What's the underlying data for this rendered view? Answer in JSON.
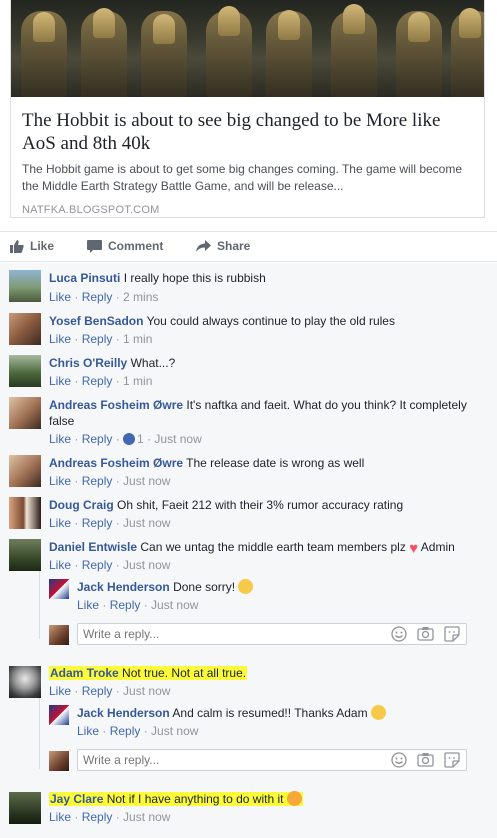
{
  "link_card": {
    "title": "The Hobbit is about to see big changed to be More like AoS and 8th 40k",
    "description": "The Hobbit game is about to get some big changes coming. The game will become the Middle Earth Strategy Battle Game, and will be release...",
    "domain": "NATFKA.BLOGSPOT.COM"
  },
  "actions": {
    "like": "Like",
    "comment": "Comment",
    "share": "Share"
  },
  "reply_placeholder": "Write a reply...",
  "comments": [
    {
      "name": "Luca Pinsuti",
      "text": "I really hope this is rubbish",
      "like": "Like",
      "reply": "Reply",
      "time": "2 mins"
    },
    {
      "name": "Yosef BenSadon",
      "text": "You could always continue to play the old rules",
      "like": "Like",
      "reply": "Reply",
      "time": "1 min"
    },
    {
      "name": "Chris O'Reilly",
      "text": "What...?",
      "like": "Like",
      "reply": "Reply",
      "time": "1 min"
    },
    {
      "name": "Andreas Fosheim Øwre",
      "text_line1": "It's naftka and faeit. What do you think? It completely",
      "text_line2": "false",
      "like": "Like",
      "reply": "Reply",
      "reactions": "1",
      "time": "Just now"
    },
    {
      "name": "Andreas Fosheim Øwre",
      "text": "The release date is wrong as well",
      "like": "Like",
      "reply": "Reply",
      "time": "Just now"
    },
    {
      "name": "Doug Craig",
      "text": "Oh shit, Faeit 212 with their 3% rumor accuracy rating",
      "like": "Like",
      "reply": "Reply",
      "time": "Just now"
    },
    {
      "name": "Daniel Entwisle",
      "text": "Can we untag the middle earth team members plz",
      "suffix": "Admin",
      "like": "Like",
      "reply": "Reply",
      "time": "Just now"
    },
    {
      "name": "Jack Henderson",
      "text": "Done sorry!",
      "like": "Like",
      "reply": "Reply",
      "time": "Just now"
    },
    {
      "name": "Adam Troke",
      "text": "Not true. Not at all true.",
      "like": "Like",
      "reply": "Reply",
      "time": "Just now"
    },
    {
      "name": "Jack Henderson",
      "text": "And calm is resumed!! Thanks Adam",
      "like": "Like",
      "reply": "Reply",
      "time": "Just now"
    },
    {
      "name": "Jay Clare",
      "text": "Not if I have anything to do with it",
      "like": "Like",
      "reply": "Reply",
      "time": "Just now"
    }
  ],
  "colors": {
    "name_link": "#365899",
    "action_link": "#4267b2",
    "meta_gray": "#90949c",
    "highlight": "#fbfb3a",
    "comments_bg": "#f6f7f9"
  },
  "icons": [
    "like-thumb-icon",
    "comment-bubble-icon",
    "share-arrow-icon",
    "emoji-icon",
    "camera-icon",
    "sticker-icon",
    "heart-icon",
    "like-reaction-icon",
    "smiley-emoji-icon",
    "tongue-emoji-icon"
  ]
}
